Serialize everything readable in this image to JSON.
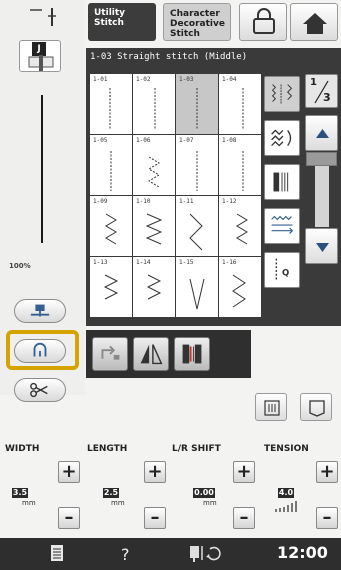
{
  "tabs": {
    "utility": "Utility Stitch",
    "character": "Character Decorative Stitch"
  },
  "left": {
    "zoom": "100%"
  },
  "panel": {
    "title": "1-03  Straight stitch (Middle)",
    "selected": "1-03",
    "stitches": [
      "1-01",
      "1-02",
      "1-03",
      "1-04",
      "1-05",
      "1-06",
      "1-07",
      "1-08",
      "1-09",
      "1-10",
      "1-11",
      "1-12",
      "1-13",
      "1-14",
      "1-15",
      "1-16"
    ]
  },
  "page": {
    "current": "1",
    "total": "3"
  },
  "settings": {
    "width": {
      "label": "WIDTH",
      "value": "3.5",
      "unit": "mm"
    },
    "length": {
      "label": "LENGTH",
      "value": "2.5",
      "unit": "mm"
    },
    "shift": {
      "label": "L/R SHIFT",
      "value": "0.00",
      "unit": "mm"
    },
    "tension": {
      "label": "TENSION",
      "value": "4.0"
    }
  },
  "status": {
    "help": "?",
    "time": "12:00"
  },
  "icons": [
    "needle-position-icon",
    "presser-foot-icon",
    "sewing-foot-icon",
    "needle-stop-icon",
    "scissors-icon",
    "lock-icon",
    "home-icon",
    "utility-stitch-icon",
    "quilt-stitch-icon",
    "satin-stitch-icon",
    "buttonhole-stitch-icon",
    "stitch-q-icon",
    "mirror-icon",
    "twin-needle-icon",
    "image-icon",
    "memory-icon",
    "manual-icon",
    "bobbin-icon"
  ]
}
